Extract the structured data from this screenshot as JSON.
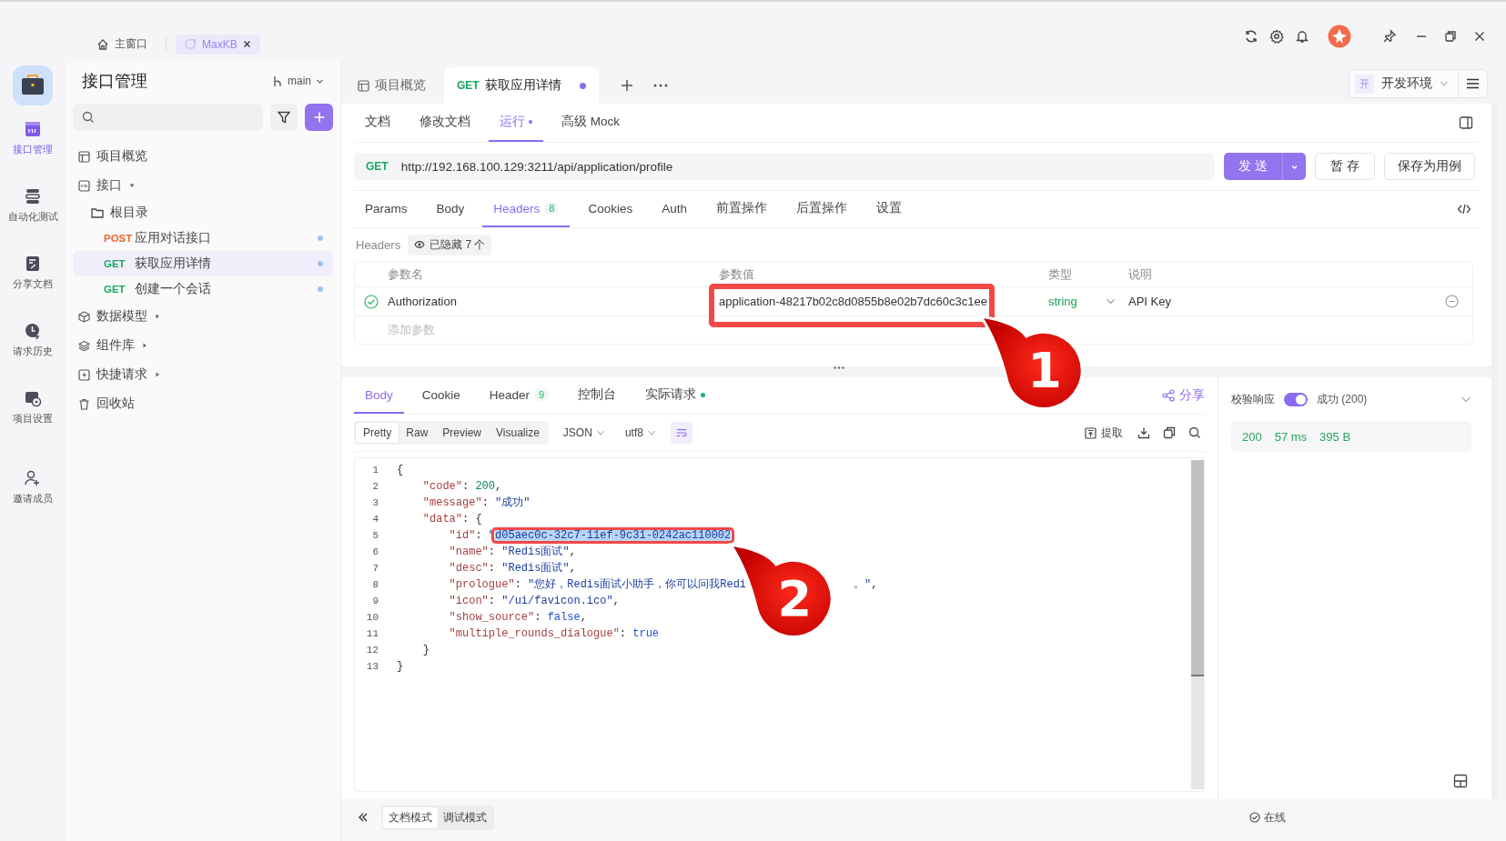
{
  "titlebar": {
    "tabs": [
      {
        "label": "主窗口",
        "selected": false,
        "closable": false
      },
      {
        "label": "MaxKB",
        "selected": true,
        "closable": true
      }
    ]
  },
  "rail": {
    "items": [
      {
        "label": "接口管理",
        "selected": true
      },
      {
        "label": "自动化测试",
        "selected": false
      },
      {
        "label": "分享文档",
        "selected": false
      },
      {
        "label": "请求历史",
        "selected": false
      },
      {
        "label": "项目设置",
        "selected": false
      },
      {
        "label": "邀请成员",
        "selected": false
      }
    ]
  },
  "sidebar": {
    "title": "接口管理",
    "branch": "main",
    "items": [
      {
        "kind": "overview",
        "label": "项目概览"
      },
      {
        "kind": "group",
        "label": "接口",
        "expanded": true,
        "children": [
          {
            "kind": "folder",
            "label": "根目录",
            "children": [
              {
                "kind": "endpoint",
                "method": "POST",
                "label": "应用对话接口",
                "selected": false
              },
              {
                "kind": "endpoint",
                "method": "GET",
                "label": "获取应用详情",
                "selected": true
              },
              {
                "kind": "endpoint",
                "method": "GET",
                "label": "创建一个会话",
                "selected": false
              }
            ]
          }
        ]
      },
      {
        "kind": "model",
        "label": "数据模型",
        "expanded": false
      },
      {
        "kind": "components",
        "label": "组件库",
        "expanded": false
      },
      {
        "kind": "quick",
        "label": "快捷请求",
        "expanded": false
      },
      {
        "kind": "trash",
        "label": "回收站"
      }
    ]
  },
  "doc_tabs": [
    {
      "label": "项目概览",
      "selected": false,
      "unsaved": false
    },
    {
      "method": "GET",
      "label": "获取应用详情",
      "selected": true,
      "unsaved": true
    }
  ],
  "environment": {
    "badge": "开",
    "label": "开发环境"
  },
  "sub_tabs": [
    {
      "label": "文档",
      "selected": false,
      "dot": false
    },
    {
      "label": "修改文档",
      "selected": false,
      "dot": false
    },
    {
      "label": "运行",
      "selected": true,
      "dot": true
    },
    {
      "label": "高级 Mock",
      "selected": false,
      "dot": false
    }
  ],
  "request": {
    "method": "GET",
    "url": "http://192.168.100.129:3211/api/application/profile",
    "send": "发 送",
    "save": "暂 存",
    "save_case": "保存为用例"
  },
  "request_tabs": [
    {
      "label": "Params",
      "selected": false
    },
    {
      "label": "Body",
      "selected": false
    },
    {
      "label": "Headers",
      "count": "8",
      "selected": true
    },
    {
      "label": "Cookies",
      "selected": false
    },
    {
      "label": "Auth",
      "selected": false
    },
    {
      "label": "前置操作",
      "selected": false
    },
    {
      "label": "后置操作",
      "selected": false
    },
    {
      "label": "设置",
      "selected": false
    }
  ],
  "headers": {
    "label": "Headers",
    "hidden_badge": "已隐藏 7 个",
    "columns": [
      "参数名",
      "参数值",
      "类型",
      "说明"
    ],
    "rows": [
      {
        "enabled": true,
        "name": "Authorization",
        "value": "application-48217b02c8d0855b8e02b7dc60c3c1ee",
        "type": "string",
        "description": "API Key",
        "callout": "1"
      }
    ],
    "add_placeholder": "添加参数"
  },
  "response_tabs": [
    {
      "label": "Body",
      "selected": true,
      "dot": false
    },
    {
      "label": "Cookie",
      "selected": false,
      "dot": false
    },
    {
      "label": "Header",
      "count": "9",
      "selected": false,
      "dot": false
    },
    {
      "label": "控制台",
      "selected": false,
      "dot": false
    },
    {
      "label": "实际请求",
      "selected": false,
      "dot": true
    }
  ],
  "share": "分享",
  "view_modes": [
    {
      "label": "Pretty",
      "selected": true
    },
    {
      "label": "Raw",
      "selected": false
    },
    {
      "label": "Preview",
      "selected": false
    },
    {
      "label": "Visualize",
      "selected": false
    }
  ],
  "format": "JSON",
  "encoding": "utf8",
  "extract": "提取",
  "code": [
    {
      "n": "1",
      "tokens": [
        {
          "kind": "punct",
          "text": "{"
        }
      ]
    },
    {
      "n": "2",
      "tokens": [
        {
          "kind": "key",
          "text": "    \"code\""
        },
        {
          "kind": "punct",
          "text": ": "
        },
        {
          "kind": "num",
          "text": "200"
        },
        {
          "kind": "punct",
          "text": ","
        }
      ]
    },
    {
      "n": "3",
      "tokens": [
        {
          "kind": "key",
          "text": "    \"message\""
        },
        {
          "kind": "punct",
          "text": ": "
        },
        {
          "kind": "str",
          "text": "\"成功\""
        }
      ]
    },
    {
      "n": "4",
      "tokens": [
        {
          "kind": "key",
          "text": "    \"data\""
        },
        {
          "kind": "punct",
          "text": ": {"
        }
      ]
    },
    {
      "n": "5",
      "tokens": [
        {
          "kind": "key",
          "text": "        \"id\""
        },
        {
          "kind": "punct",
          "text": ": "
        },
        {
          "kind": "str",
          "text": "\""
        },
        {
          "kind": "str",
          "text": "d05aec0c-32c7-11ef-9c31-0242ac110002",
          "selected": true,
          "callout": "2"
        }
      ]
    },
    {
      "n": "6",
      "tokens": [
        {
          "kind": "key",
          "text": "        \"name\""
        },
        {
          "kind": "punct",
          "text": ": "
        },
        {
          "kind": "str",
          "text": "\"Redis面试\""
        },
        {
          "kind": "punct",
          "text": ","
        }
      ]
    },
    {
      "n": "7",
      "tokens": [
        {
          "kind": "key",
          "text": "        \"desc\""
        },
        {
          "kind": "punct",
          "text": ": "
        },
        {
          "kind": "str",
          "text": "\"Redis面试\""
        },
        {
          "kind": "punct",
          "text": ","
        }
      ]
    },
    {
      "n": "8",
      "tokens": [
        {
          "kind": "key",
          "text": "        \"prologue\""
        },
        {
          "kind": "punct",
          "text": ": "
        },
        {
          "kind": "str",
          "text": "\"您好，Redis面试小助手，你可以问我Redi"
        }
      ],
      "tail": [
        {
          "kind": "str",
          "text": "。\""
        },
        {
          "kind": "punct",
          "text": ","
        }
      ]
    },
    {
      "n": "9",
      "tokens": [
        {
          "kind": "key",
          "text": "        \"icon\""
        },
        {
          "kind": "punct",
          "text": ": "
        },
        {
          "kind": "str",
          "text": "\"/ui/favicon.ico\""
        },
        {
          "kind": "punct",
          "text": ","
        }
      ]
    },
    {
      "n": "10",
      "tokens": [
        {
          "kind": "key",
          "text": "        \"show_source\""
        },
        {
          "kind": "punct",
          "text": ": "
        },
        {
          "kind": "bool",
          "text": "false"
        },
        {
          "kind": "punct",
          "text": ","
        }
      ]
    },
    {
      "n": "11",
      "tokens": [
        {
          "kind": "key",
          "text": "        \"multiple_rounds_dialogue\""
        },
        {
          "kind": "punct",
          "text": ": "
        },
        {
          "kind": "bool",
          "text": "true"
        }
      ]
    },
    {
      "n": "12",
      "tokens": [
        {
          "kind": "punct",
          "text": "    }"
        }
      ]
    },
    {
      "n": "13",
      "tokens": [
        {
          "kind": "punct",
          "text": "}"
        }
      ]
    }
  ],
  "validation": {
    "label": "校验响应",
    "on": true,
    "result": "成功 (200)"
  },
  "stats": {
    "status": "200",
    "time": "57 ms",
    "size": "395 B"
  },
  "footer": {
    "modes": [
      {
        "label": "文档模式",
        "selected": true
      },
      {
        "label": "调试模式",
        "selected": false
      }
    ],
    "status": "在线"
  }
}
